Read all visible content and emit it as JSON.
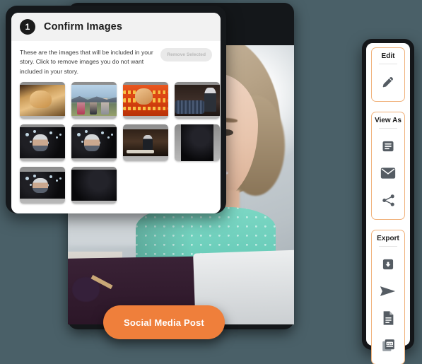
{
  "theme": {
    "background": "#4a6068",
    "accent_orange": "#ef7f3b",
    "panel_border": "#f0b17a",
    "header_bg": "#f2f2f2",
    "badge_bg": "#1b1b1b",
    "icon_gray": "#555c63"
  },
  "dialog": {
    "step_number": "1",
    "title": "Confirm Images",
    "description": "These are the images that will be included in your story. Click to remove images you do not want included in your story.",
    "remove_selected_label": "Remove Selected",
    "thumbnails": [
      {
        "name": "thumbnail-1",
        "scene": "sc-gold",
        "shape": "wide"
      },
      {
        "name": "thumbnail-2",
        "scene": "sc-mtn",
        "shape": "wide"
      },
      {
        "name": "thumbnail-3",
        "scene": "sc-red",
        "shape": "wide"
      },
      {
        "name": "thumbnail-4",
        "scene": "sc-room",
        "shape": "wide"
      },
      {
        "name": "thumbnail-5",
        "scene": "sc-pow",
        "shape": "wide"
      },
      {
        "name": "thumbnail-6",
        "scene": "sc-pow",
        "shape": "wide"
      },
      {
        "name": "thumbnail-7",
        "scene": "sc-desk",
        "shape": "std"
      },
      {
        "name": "thumbnail-8",
        "scene": "sc-pow2",
        "shape": "tall"
      },
      {
        "name": "thumbnail-9",
        "scene": "sc-pow",
        "shape": "std"
      },
      {
        "name": "thumbnail-10",
        "scene": "sc-pow2",
        "shape": "wide"
      }
    ]
  },
  "primary_action": {
    "label": "Social Media Post"
  },
  "toolbar": {
    "panels": [
      {
        "title": "Edit",
        "icons": [
          {
            "name": "pencil-icon",
            "glyph": "pencil"
          }
        ]
      },
      {
        "title": "View As",
        "icons": [
          {
            "name": "document-view-icon",
            "glyph": "article"
          },
          {
            "name": "email-icon",
            "glyph": "envelope"
          },
          {
            "name": "share-icon",
            "glyph": "share"
          }
        ]
      },
      {
        "title": "Export",
        "icons": [
          {
            "name": "download-icon",
            "glyph": "download"
          },
          {
            "name": "send-icon",
            "glyph": "send"
          },
          {
            "name": "text-file-icon",
            "glyph": "file"
          },
          {
            "name": "pdf-file-icon",
            "glyph": "pdf"
          }
        ]
      }
    ]
  }
}
